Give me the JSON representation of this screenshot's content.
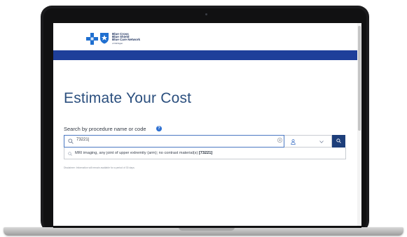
{
  "brand": {
    "name_lines": [
      "Blue Cross",
      "Blue Shield",
      "Blue Care Network"
    ],
    "region": "of Michigan",
    "colors": {
      "primary_bar": "#1e3f9a",
      "title": "#2b4f7e",
      "button": "#1d3e7a",
      "help": "#2c6fd1"
    }
  },
  "page": {
    "title": "Estimate Your Cost"
  },
  "search": {
    "label": "Search by procedure name or code",
    "help_symbol": "?",
    "value": "73221|",
    "suggestions": [
      {
        "text": "MRI imaging, any joint of upper extremity (arm); no contrast material(s)",
        "code": "[73221]"
      }
    ]
  },
  "disclaimer": "Disclaimer: Information will remain available for a period of 30 days.",
  "icons": [
    "search-icon",
    "clear-icon",
    "person-icon",
    "chevron-down-icon",
    "help-icon"
  ]
}
